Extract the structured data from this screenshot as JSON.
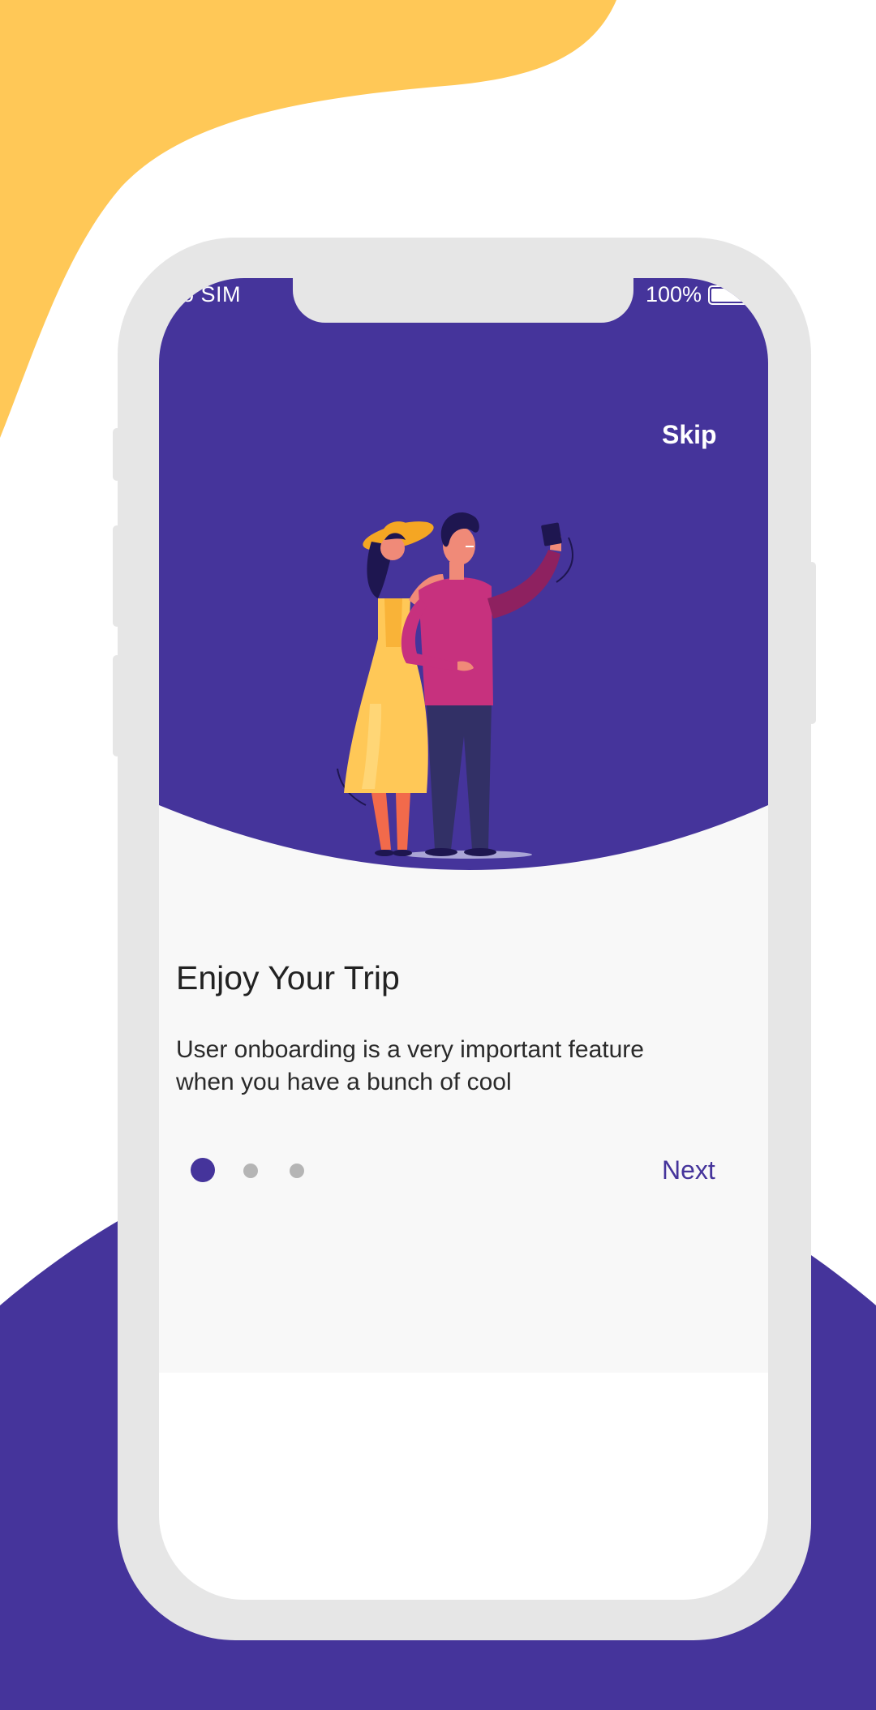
{
  "colors": {
    "primary": "#45349b",
    "accent_yellow": "#ffc857",
    "frame": "#e6e6e6",
    "content_bg": "#f8f8f8",
    "title_text": "#222222",
    "dot_inactive": "#b5b5b5"
  },
  "status_bar": {
    "carrier": "No SIM",
    "battery_percent": "100%",
    "battery_icon": "battery-icon"
  },
  "onboarding": {
    "skip_label": "Skip",
    "illustration": "couple-selfie-illustration",
    "title": "Enjoy Your Trip",
    "description": "User onboarding is a very important feature when you have a bunch of cool",
    "page_indicator": {
      "total": 3,
      "active_index": 0
    },
    "next_label": "Next"
  }
}
